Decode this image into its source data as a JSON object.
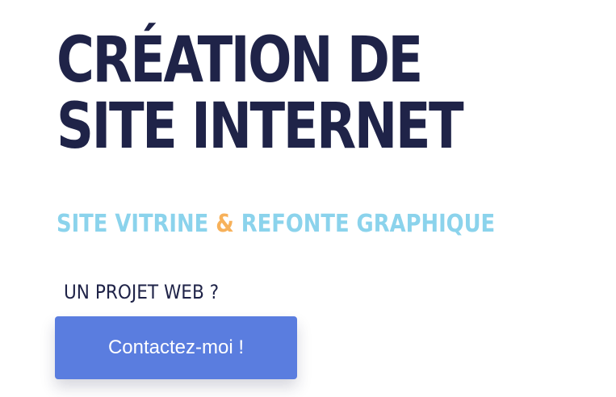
{
  "hero": {
    "title_line1": "CRÉATION DE",
    "title_line2": "SITE INTERNET",
    "subtitle_part1": "SITE VITRINE ",
    "subtitle_amp": "&",
    "subtitle_part2": " REFONTE GRAPHIQUE",
    "question": "UN PROJET WEB ?",
    "cta_label": "Contactez-moi !"
  },
  "colors": {
    "title": "#1f2348",
    "subtitle": "#8bd3ec",
    "ampersand": "#f7b15a",
    "button": "#5a7ddf",
    "button_text": "#ffffff"
  }
}
